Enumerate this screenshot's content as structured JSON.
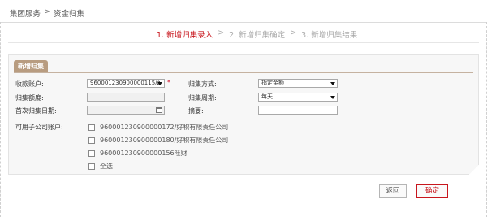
{
  "breadcrumb": {
    "item1": "集团服务",
    "separator": ">",
    "item2": "资金归集"
  },
  "steps": {
    "step1": "1. 新增归集录入",
    "arrow1": ">",
    "step2": "2. 新增归集确定",
    "arrow2": ">",
    "step3": "3. 新增归集结果"
  },
  "panel": {
    "title": "新增归集"
  },
  "form": {
    "receive_account_label": "收款账户:",
    "receive_account_value": "960001230900000115/ž",
    "required_mark": "*",
    "collect_mode_label": "归集方式:",
    "collect_mode_value": "指定金额",
    "collect_amount_label": "归集额度:",
    "collect_period_label": "归集周期:",
    "collect_period_value": "每天",
    "first_date_label": "首次归集日期:",
    "summary_label": "摘要:",
    "sub_accounts_label": "可用子公司账户:",
    "sub_accounts": [
      "960001230900000172/好积有限责任公司",
      "960001230900000180/好积有限责任公司",
      "960001230900000156旺财"
    ],
    "select_all_label": "全选"
  },
  "buttons": {
    "back": "返回",
    "confirm": "确定"
  },
  "colors": {
    "accent": "#c8161d",
    "tab": "#b89c80"
  }
}
